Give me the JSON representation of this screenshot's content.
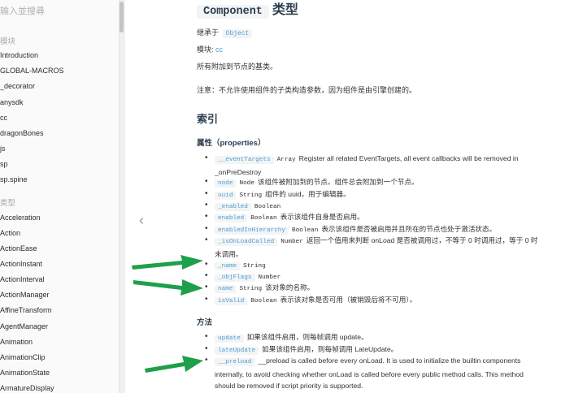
{
  "sidebar": {
    "search_placeholder": "输入並搜尋",
    "sections": [
      {
        "label": "模块",
        "items": [
          "Introduction",
          "GLOBAL-MACROS",
          "_decorator",
          "anysdk",
          "cc",
          "dragonBones",
          "js",
          "sp",
          "sp.spine"
        ]
      },
      {
        "label": "类型",
        "items": [
          "Acceleration",
          "Action",
          "ActionEase",
          "ActionInstant",
          "ActionInterval",
          "ActionManager",
          "AffineTransform",
          "AgentManager",
          "Animation",
          "AnimationClip",
          "AnimationState",
          "ArmatureDisplay"
        ]
      }
    ]
  },
  "nav": {
    "prev_icon": "chevron-left-icon",
    "prev_symbol": "‹"
  },
  "page": {
    "title_code": "Component",
    "title_suffix": "类型",
    "extends_label": "继承于",
    "extends_value": "Object",
    "module_label": "模块:",
    "module_value": "cc",
    "description": "所有附加到节点的基类。",
    "note": "注意：不允许使用组件的子类构造参数，因为组件是由引擎创建的。",
    "index_heading": "索引",
    "properties_heading": "属性（properties）",
    "properties": [
      {
        "name": "__eventTargets",
        "type": "Array",
        "desc": "Register all related EventTargets, all event callbacks will be removed in _onPreDestroy"
      },
      {
        "name": "node",
        "type": "Node",
        "desc": "该组件被附加到的节点。组件总会附加到一个节点。"
      },
      {
        "name": "uuid",
        "type": "String",
        "desc": "组件的 uuid，用于编辑器。"
      },
      {
        "name": "_enabled",
        "type": "Boolean",
        "desc": ""
      },
      {
        "name": "enabled",
        "type": "Boolean",
        "desc": "表示该组件自身是否启用。"
      },
      {
        "name": "enabledInHierarchy",
        "type": "Boolean",
        "desc": "表示该组件是否被启用并且所在的节点也处于激活状态。"
      },
      {
        "name": "_isOnLoadCalled",
        "type": "Number",
        "desc": "返回一个值用来判断 onLoad 是否被调用过，不等于 0 时调用过，等于 0 时未调用。"
      },
      {
        "name": "_name",
        "type": "String",
        "desc": ""
      },
      {
        "name": "_objFlags",
        "type": "Number",
        "desc": ""
      },
      {
        "name": "name",
        "type": "String",
        "desc": "该对象的名称。"
      },
      {
        "name": "isValid",
        "type": "Boolean",
        "desc": "表示该对象是否可用（被销毁后将不可用）。"
      }
    ],
    "methods_heading": "方法",
    "methods": [
      {
        "name": "update",
        "desc": "如果该组件启用，则每帧调用 update。"
      },
      {
        "name": "lateUpdate",
        "desc": "如果该组件启用，则每帧调用 LateUpdate。"
      },
      {
        "name": "__preload",
        "desc": "__preload  is called before every onLoad. It is used to initialize the builtin components internally, to avoid checking whether onLoad is called before every public method calls. This method should be removed if script priority is supported."
      }
    ]
  },
  "annotations": {
    "arrow_color": "#1ea04a",
    "arrow_icon": "green-arrow-icon"
  }
}
